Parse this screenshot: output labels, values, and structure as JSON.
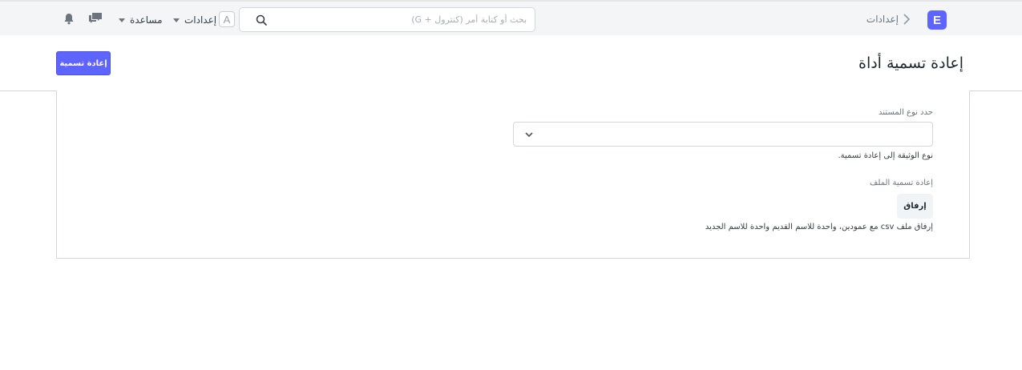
{
  "navbar": {
    "logo_letter": "E",
    "breadcrumb": "إعدادات",
    "search_placeholder": "بحث أو كتابة أمر (كنترول + G)",
    "avatar_letter": "A",
    "settings_label": "إعدادات",
    "help_label": "مساعدة"
  },
  "page": {
    "title": "إعادة تسمية أداة",
    "primary_action": "إعادة تسمية"
  },
  "form": {
    "doctype_label": "حدد نوع المستند",
    "doctype_value": "",
    "doctype_help": "نوع الوثيقة إلى إعادة تسمية.",
    "file_label": "إعادة تسمية الملف",
    "attach_label": "إرفاق",
    "file_help": "إرفاق ملف csv مع عمودين، واحدة للاسم القديم واحدة للاسم الجديد"
  },
  "colors": {
    "primary": "#5e64ff",
    "navbar_bg": "#f4f5f6",
    "border": "#d1d8dd"
  },
  "icons": {
    "search": "search-icon",
    "breadcrumb_separator": "chevron-right-icon",
    "notifications": "bell-icon",
    "chat": "chat-icon",
    "select": "chevron-down-icon"
  }
}
